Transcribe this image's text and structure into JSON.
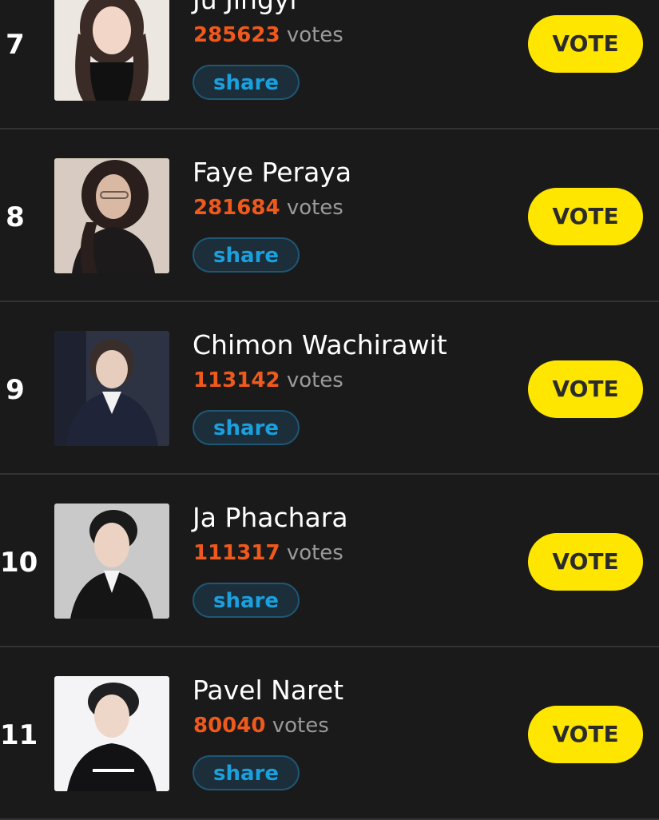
{
  "colors": {
    "background": "#1a1a1a",
    "vote_count": "#f0591c",
    "vote_button": "#ffe600",
    "share_text": "#1aa0de"
  },
  "rows": [
    {
      "rank": "7",
      "name": "Ju Jingyi",
      "votes": "285623",
      "votes_label": "votes",
      "share_label": "share",
      "vote_label": "VOTE",
      "photo": "portrait-photo"
    },
    {
      "rank": "8",
      "name": "Faye Peraya",
      "votes": "281684",
      "votes_label": "votes",
      "share_label": "share",
      "vote_label": "VOTE",
      "photo": "portrait-photo"
    },
    {
      "rank": "9",
      "name": "Chimon Wachirawit",
      "votes": "113142",
      "votes_label": "votes",
      "share_label": "share",
      "vote_label": "VOTE",
      "photo": "portrait-photo"
    },
    {
      "rank": "10",
      "name": "Ja Phachara",
      "votes": "111317",
      "votes_label": "votes",
      "share_label": "share",
      "vote_label": "VOTE",
      "photo": "portrait-photo"
    },
    {
      "rank": "11",
      "name": "Pavel Naret",
      "votes": "80040",
      "votes_label": "votes",
      "share_label": "share",
      "vote_label": "VOTE",
      "photo": "portrait-photo"
    }
  ]
}
